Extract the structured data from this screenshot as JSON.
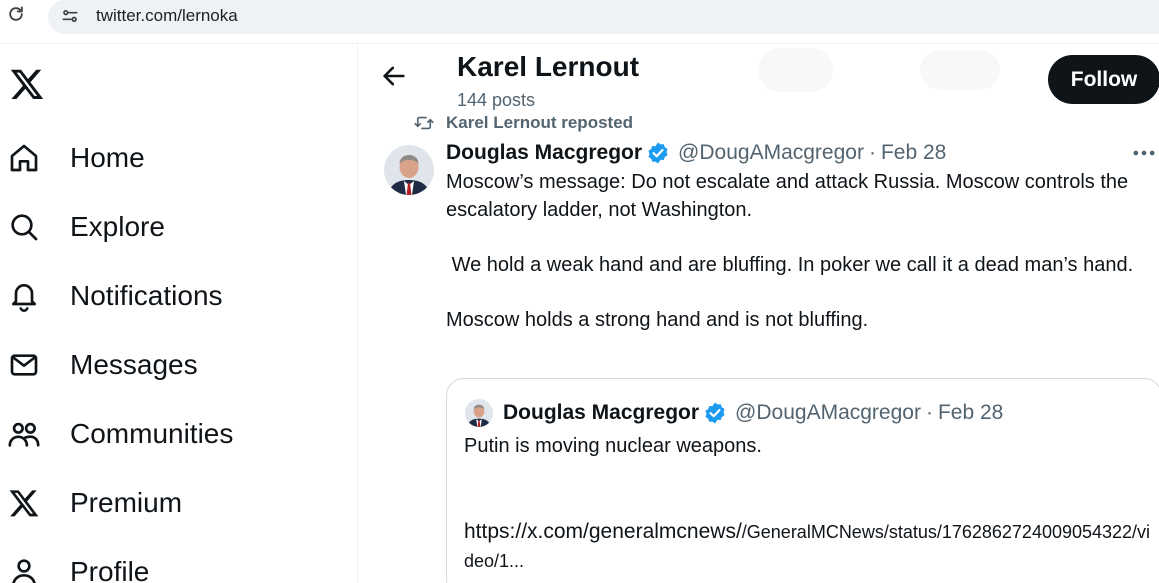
{
  "browser": {
    "url": "twitter.com/lernoka"
  },
  "sidebar": {
    "logo_icon": "x-logo",
    "items": [
      {
        "label": "Home",
        "icon": "home-icon"
      },
      {
        "label": "Explore",
        "icon": "search-icon"
      },
      {
        "label": "Notifications",
        "icon": "bell-icon"
      },
      {
        "label": "Messages",
        "icon": "envelope-icon"
      },
      {
        "label": "Communities",
        "icon": "people-icon"
      },
      {
        "label": "Premium",
        "icon": "x-logo-icon"
      },
      {
        "label": "Profile",
        "icon": "person-icon"
      }
    ]
  },
  "header": {
    "name": "Karel Lernout",
    "posts": "144 posts",
    "follow_label": "Follow"
  },
  "tweet": {
    "repost_label": "Karel Lernout reposted",
    "author_name": "Douglas Macgregor",
    "author_handle": "@DougAMacgregor",
    "separator": "·",
    "date": "Feb 28",
    "text": "Moscow’s message: Do not escalate and attack Russia. Moscow controls the escalatory ladder, not Washington.\n\n We hold a weak hand and are bluffing. In poker we call it a dead man’s hand.\n\nMoscow holds a strong hand and is not bluffing.",
    "quote": {
      "author_name": "Douglas Macgregor",
      "author_handle": "@DougAMacgregor",
      "separator": "·",
      "date": "Feb 28",
      "text": "Putin is moving nuclear weapons.",
      "link_main": "https://x.com/generalmcnews/",
      "link_rest": "/GeneralMCNews/status/1762862724009054322/video/1..."
    }
  },
  "colors": {
    "text_primary": "#0f1419",
    "text_secondary": "#536471",
    "verified_blue": "#1d9bf0",
    "follow_bg": "#0f1419",
    "border": "#cfd9de"
  }
}
